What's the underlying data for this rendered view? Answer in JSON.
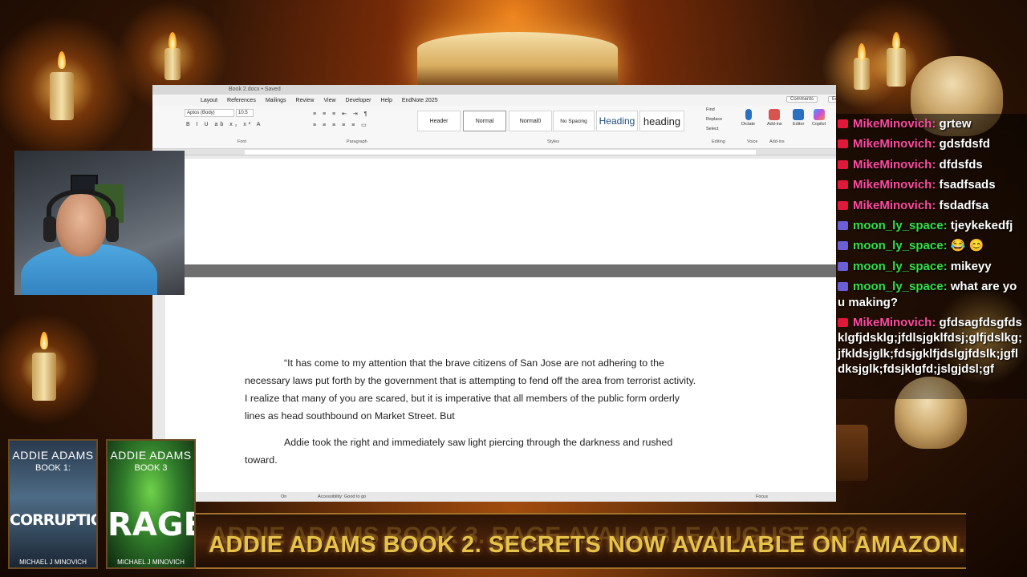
{
  "word": {
    "title": "Book 2.docx • Saved",
    "menu": [
      "Layout",
      "References",
      "Mailings",
      "Review",
      "View",
      "Developer",
      "Help",
      "EndNote 2025"
    ],
    "comments_label": "Comments",
    "editing_label": "Editing",
    "font_name": "Aptos (Body)",
    "font_size": "10.5",
    "group_labels": {
      "font": "Font",
      "paragraph": "Paragraph",
      "styles": "Styles",
      "editing": "Editing",
      "voice": "Voice",
      "addins": "Add-ins"
    },
    "styles": [
      "Header",
      "Normal",
      "Normal0",
      "No Spacing",
      "Heading",
      "heading"
    ],
    "find_label": "Find",
    "replace_label": "Replace",
    "select_label": "Select",
    "dictate_label": "Dictate",
    "addins_label": "Add-ins",
    "editor_label": "Editor",
    "copilot_label": "Copilot",
    "document": {
      "lines": [
        "“It has come to my attention that the brave citizens of San Jose are not adhering to the",
        "necessary laws put forth by the government that is attempting to fend off the area from terrorist activity.",
        "I realize that many of you are scared, but it is imperative that all members of the public form orderly",
        "lines as head southbound on Market Street. But"
      ],
      "para2_lines": [
        "Addie took the right and immediately saw light piercing through the darkness and rushed",
        "toward."
      ]
    },
    "status": {
      "on": "On",
      "accessibility": "Accessibility: Good to go",
      "focus": "Focus"
    }
  },
  "chat": {
    "messages": [
      {
        "platform": "youtube",
        "user": "MikeMinovich",
        "text": "grtew"
      },
      {
        "platform": "youtube",
        "user": "MikeMinovich",
        "text": "gdsfdsfd"
      },
      {
        "platform": "youtube",
        "user": "MikeMinovich",
        "text": "dfdsfds"
      },
      {
        "platform": "youtube",
        "user": "MikeMinovich",
        "text": "fsadfsads"
      },
      {
        "platform": "youtube",
        "user": "MikeMinovich",
        "text": "fsdadfsa"
      },
      {
        "platform": "twitch",
        "user": "moon_ly_space",
        "text": "tjeykekedfj"
      },
      {
        "platform": "twitch",
        "user": "moon_ly_space",
        "text": "😂 😊"
      },
      {
        "platform": "twitch",
        "user": "moon_ly_space",
        "text": "mikeyy"
      },
      {
        "platform": "twitch",
        "user": "moon_ly_space",
        "text": "what are you making?"
      },
      {
        "platform": "youtube",
        "user": "MikeMinovich",
        "text": "gfdsagfdsgfdsklgfjdsklg;jfdlsjgklfdsj;glfjdslkg;jfkldsjglk;fdsjgklfjdslgjfdslk;jgfldksjglk;fdsjklgfd;jslgjdsl;gf"
      }
    ]
  },
  "covers": [
    {
      "series": "ADDIE ADAMS",
      "book": "BOOK 1:",
      "title": "CORRUPTION",
      "author": "MICHAEL J MINOVICH"
    },
    {
      "series": "ADDIE ADAMS",
      "book": "BOOK 3",
      "title": "RAGE",
      "author": "MICHAEL J MINOVICH"
    }
  ],
  "banner": {
    "text": "ADDIE ADAMS BOOK 2. SECRETS NOW AVAILABLE ON AMAZON.",
    "ghost_text": "ADDIE ADAMS BOOK 3. RAGE AVAILABLE AUGUST 2026"
  },
  "colors": {
    "mm_user": "#ff4aa0",
    "moon_user": "#32e04a",
    "banner_gold": "#e8c34a",
    "youtube_badge": "#e0183a",
    "twitch_badge": "#6b5fd6"
  }
}
